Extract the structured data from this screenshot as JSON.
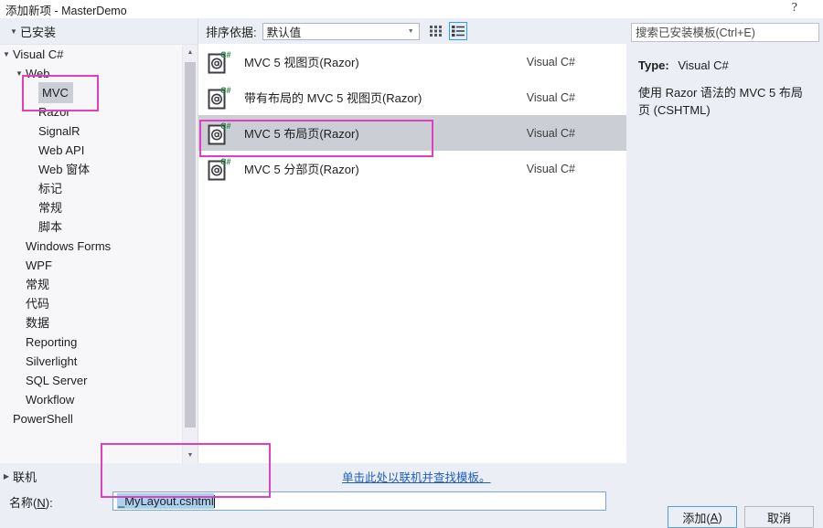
{
  "window": {
    "title": "添加新项 - MasterDemo",
    "help_icon": "help-question-icon"
  },
  "tree": {
    "header": "已安装",
    "nodes": [
      {
        "label": "Visual C#",
        "level": 0,
        "caret": "expanded",
        "selected": false
      },
      {
        "label": "Web",
        "level": 1,
        "caret": "expanded",
        "selected": false
      },
      {
        "label": "MVC",
        "level": 2,
        "caret": "none",
        "selected": true
      },
      {
        "label": "Razor",
        "level": 2,
        "caret": "none",
        "selected": false
      },
      {
        "label": "SignalR",
        "level": 2,
        "caret": "none",
        "selected": false
      },
      {
        "label": "Web API",
        "level": 2,
        "caret": "none",
        "selected": false
      },
      {
        "label": "Web 窗体",
        "level": 2,
        "caret": "none",
        "selected": false
      },
      {
        "label": "标记",
        "level": 2,
        "caret": "none",
        "selected": false
      },
      {
        "label": "常规",
        "level": 2,
        "caret": "none",
        "selected": false
      },
      {
        "label": "脚本",
        "level": 2,
        "caret": "none",
        "selected": false
      },
      {
        "label": "Windows Forms",
        "level": 1,
        "caret": "none",
        "selected": false
      },
      {
        "label": "WPF",
        "level": 1,
        "caret": "none",
        "selected": false
      },
      {
        "label": "常规",
        "level": 1,
        "caret": "none",
        "selected": false
      },
      {
        "label": "代码",
        "level": 1,
        "caret": "none",
        "selected": false
      },
      {
        "label": "数据",
        "level": 1,
        "caret": "none",
        "selected": false
      },
      {
        "label": "Reporting",
        "level": 1,
        "caret": "none",
        "selected": false
      },
      {
        "label": "Silverlight",
        "level": 1,
        "caret": "none",
        "selected": false
      },
      {
        "label": "SQL Server",
        "level": 1,
        "caret": "none",
        "selected": false
      },
      {
        "label": "Workflow",
        "level": 1,
        "caret": "none",
        "selected": false
      },
      {
        "label": "PowerShell",
        "level": 0,
        "caret": "none",
        "selected": false
      }
    ],
    "online_node": {
      "label": "联机",
      "caret": "collapsed"
    }
  },
  "toolbar": {
    "sort_label": "排序依据:",
    "sort_value": "默认值",
    "tile_view_icon": "tile-view-icon",
    "list_view_icon": "list-view-icon",
    "active_view": "list"
  },
  "templates": [
    {
      "name": "MVC 5 视图页(Razor)",
      "language": "Visual C#",
      "icon": "razor-view-csharp-icon",
      "selected": false
    },
    {
      "name": "带有布局的 MVC 5 视图页(Razor)",
      "language": "Visual C#",
      "icon": "razor-view-csharp-icon",
      "selected": false
    },
    {
      "name": "MVC 5 布局页(Razor)",
      "language": "Visual C#",
      "icon": "razor-view-csharp-icon",
      "selected": true
    },
    {
      "name": "MVC 5 分部页(Razor)",
      "language": "Visual C#",
      "icon": "razor-view-csharp-icon",
      "selected": false
    }
  ],
  "search": {
    "placeholder": "搜索已安装模板(Ctrl+E)",
    "value": ""
  },
  "details": {
    "type_label": "Type:",
    "type_value": "Visual C#",
    "description": "使用 Razor 语法的 MVC 5 布局页 (CSHTML)"
  },
  "online_link": "单击此处以联机并查找模板。",
  "name_field": {
    "label": "名称(N):",
    "label_plain": "名称(",
    "label_accel": "N",
    "label_tail": "):",
    "value": "_MyLayout.cshtml"
  },
  "buttons": {
    "add": "添加(A)",
    "add_plain": "添加(",
    "add_accel": "A",
    "add_tail": ")",
    "cancel": "取消"
  },
  "colors": {
    "annotation": "#e040c0",
    "selection": "#ccced6",
    "dialog_bg": "#eceef5",
    "link": "#1f5fbf",
    "text_selection": "#a8d1f0",
    "csharp_green": "#1f8a3b"
  }
}
